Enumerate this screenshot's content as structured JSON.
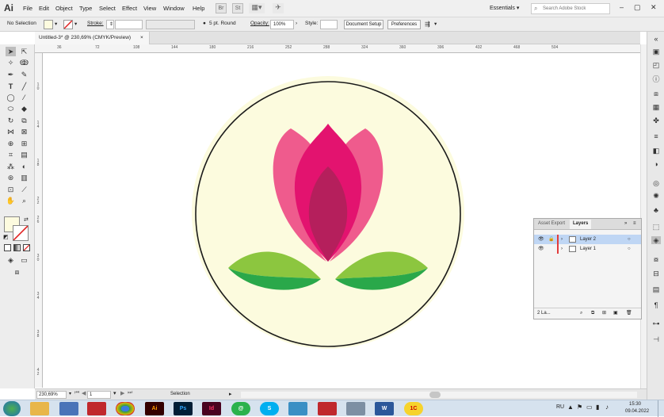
{
  "app": {
    "logo": "Ai"
  },
  "menus": [
    "File",
    "Edit",
    "Object",
    "Type",
    "Select",
    "Effect",
    "View",
    "Window",
    "Help"
  ],
  "menubar": {
    "br_label": "Br",
    "st_label": "St",
    "workspace": "Essentials",
    "search_placeholder": "Search Adobe Stock"
  },
  "control": {
    "selection": "No Selection",
    "stroke_label": "Stroke:",
    "brush": "5 pt. Round",
    "opacity_label": "Opacity:",
    "opacity_value": "100%",
    "style_label": "Style:",
    "doc_setup": "Document Setup",
    "preferences": "Preferences"
  },
  "doc_tab": {
    "title": "Untitled-3* @ 230,69% (CMYK/Preview)",
    "close": "×"
  },
  "ruler_top": [
    "36",
    "72",
    "108",
    "144",
    "180",
    "216",
    "252",
    "288",
    "324",
    "360",
    "396",
    "432",
    "468",
    "504"
  ],
  "ruler_left": [
    "1\n0",
    "1\n4",
    "1\n8",
    "2\n2",
    "2\n6",
    "3\n0",
    "3\n4",
    "3\n8",
    "4\n2"
  ],
  "status": {
    "zoom": "230,69%",
    "artboard": "1",
    "tool": "Selection"
  },
  "layers_panel": {
    "tabs": [
      "Asset Export",
      "Layers"
    ],
    "rows": [
      {
        "name": "Layer 2",
        "selected": true
      },
      {
        "name": "Layer 1",
        "selected": false
      }
    ],
    "footer": "2 La..."
  },
  "taskbar": {
    "apps": [
      {
        "name": "explorer",
        "label": "",
        "color": "#e8b64a"
      },
      {
        "name": "network",
        "label": "",
        "color": "#4a74b8"
      },
      {
        "name": "acrobat",
        "label": "",
        "color": "#c0282d"
      },
      {
        "name": "chrome",
        "label": "",
        "color": "#2f9e44"
      },
      {
        "name": "illustrator",
        "label": "Ai",
        "color": "#330000"
      },
      {
        "name": "photoshop",
        "label": "Ps",
        "color": "#001e36"
      },
      {
        "name": "indesign",
        "label": "Id",
        "color": "#49021f"
      },
      {
        "name": "messenger",
        "label": "@",
        "color": "#2bb24c"
      },
      {
        "name": "skype",
        "label": "S",
        "color": "#00aff0"
      },
      {
        "name": "files",
        "label": "",
        "color": "#3b8fc4"
      },
      {
        "name": "acrobat-2",
        "label": "",
        "color": "#c0282d"
      },
      {
        "name": "tool",
        "label": "",
        "color": "#7d8fa3"
      },
      {
        "name": "word",
        "label": "W",
        "color": "#2b579a"
      },
      {
        "name": "app-1c",
        "label": "1C",
        "color": "#f6d32d"
      }
    ],
    "lang": "RU",
    "time": "15:30",
    "date": "09.04.2022"
  },
  "colors": {
    "fill": "#fdfbdf",
    "circle": "#fcfbde",
    "petal_light": "#ef5b8d",
    "petal_mid": "#e3136f",
    "petal_dark": "#b51f5c",
    "leaf_light": "#8cc63f",
    "leaf_dark": "#2aa84a"
  }
}
